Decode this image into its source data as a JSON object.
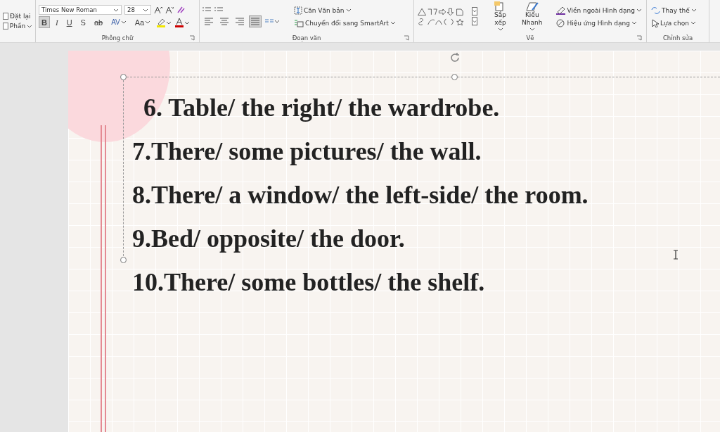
{
  "ribbon": {
    "slides_group": {
      "commands": [
        {
          "label": "Đặt lại",
          "dropdown": false
        },
        {
          "label": "Phần",
          "dropdown": true
        }
      ]
    },
    "font_group": {
      "font_name": "Times New Roman",
      "font_size": "28",
      "label": "Phông chữ",
      "format_buttons": [
        {
          "kind": "bold",
          "label": "B",
          "selected": true
        },
        {
          "kind": "italic",
          "label": "I",
          "selected": false
        },
        {
          "kind": "underline",
          "label": "U",
          "selected": false
        },
        {
          "kind": "shadow",
          "label": "S",
          "selected": false
        },
        {
          "kind": "strike",
          "label": "ab",
          "selected": false
        },
        {
          "kind": "spacing",
          "label": "AV",
          "selected": false
        },
        {
          "kind": "case",
          "label": "Aa",
          "selected": false
        }
      ]
    },
    "paragraph_group": {
      "label": "Đoạn văn",
      "align_buttons": [
        {
          "kind": "left",
          "selected": false
        },
        {
          "kind": "center",
          "selected": false
        },
        {
          "kind": "right",
          "selected": false
        },
        {
          "kind": "justify",
          "selected": true
        }
      ],
      "commands": [
        "Căn Văn bản",
        "Chuyển đổi sang SmartArt"
      ]
    },
    "drawing_group": {
      "label": "Vẽ",
      "buttons": [
        "Sắp xếp",
        "Kiểu Nhanh"
      ],
      "commands": [
        "Viền ngoài Hình dạng",
        "Hiệu ứng Hình dạng"
      ]
    },
    "editing_group": {
      "label": "Chỉnh sửa",
      "commands": [
        "Thay thế",
        "Lựa chọn"
      ]
    }
  },
  "slide": {
    "lines": [
      {
        "text": "6. Table/ the right/ the wardrobe.",
        "indented": true
      },
      {
        "text": "7.There/ some pictures/ the wall.",
        "indented": false
      },
      {
        "text": "8.There/ a window/ the left-side/ the room.",
        "indented": false
      },
      {
        "text": "9.Bed/ opposite/ the door.",
        "indented": false
      },
      {
        "text": "10.There/ some bottles/ the shelf.",
        "indented": false
      }
    ]
  }
}
